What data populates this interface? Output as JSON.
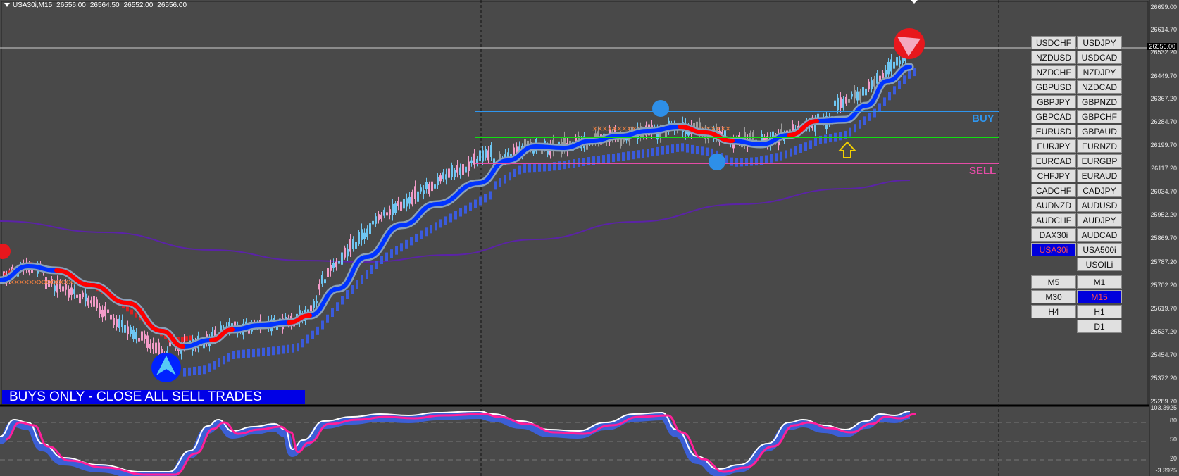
{
  "header": {
    "symbol": "USA30i,M15",
    "open": "26556.00",
    "high": "26564.50",
    "low": "26552.00",
    "close": "26556.00"
  },
  "price_axis": [
    "26699.00",
    "26614.70",
    "26532.20",
    "26449.70",
    "26367.20",
    "26284.70",
    "26199.70",
    "26117.20",
    "26034.70",
    "25952.20",
    "25869.70",
    "25787.20",
    "25702.20",
    "25619.70",
    "25537.20",
    "25454.70",
    "25372.20",
    "25289.70"
  ],
  "current_price": "26556.00",
  "indicator_axis": [
    "103.3925",
    "80",
    "50",
    "20",
    "-3.3925"
  ],
  "levels": {
    "buy_label": "BUY",
    "sell_label": "SELL"
  },
  "banner": "BUYS ONLY - CLOSE ALL SELL TRADES",
  "symbols": [
    [
      "USDCHF",
      "USDJPY"
    ],
    [
      "NZDUSD",
      "USDCAD"
    ],
    [
      "NZDCHF",
      "NZDJPY"
    ],
    [
      "GBPUSD",
      "NZDCAD"
    ],
    [
      "GBPJPY",
      "GBPNZD"
    ],
    [
      "GBPCAD",
      "GBPCHF"
    ],
    [
      "EURUSD",
      "GBPAUD"
    ],
    [
      "EURJPY",
      "EURNZD"
    ],
    [
      "EURCAD",
      "EURGBP"
    ],
    [
      "CHFJPY",
      "EURAUD"
    ],
    [
      "CADCHF",
      "CADJPY"
    ],
    [
      "AUDNZD",
      "AUDUSD"
    ],
    [
      "AUDCHF",
      "AUDJPY"
    ],
    [
      "DAX30i",
      "AUDCAD"
    ],
    [
      "USA30i",
      "USA500i"
    ],
    [
      "",
      "USOILi"
    ]
  ],
  "active_symbol": "USA30i",
  "timeframes": [
    [
      "M5",
      "M1"
    ],
    [
      "M30",
      "M15"
    ],
    [
      "H4",
      "H1"
    ],
    [
      "",
      "D1"
    ]
  ],
  "active_timeframe": "M15",
  "colors": {
    "background": "#494949",
    "buy": "#2f96ef",
    "sell": "#e54ca7",
    "mid": "#11dd11",
    "bull_candle": "#6ec6f2",
    "bear_candle": "#f29bc8",
    "flat_candle": "#9a9a9a",
    "ma_up": "#0033ff",
    "ma_down": "#ff0000",
    "long_ma": "#5b23a7"
  },
  "icons": [
    "buy-arrow-icon",
    "sell-arrow-icon",
    "up-arrow-icon",
    "dropdown-triangle-icon"
  ]
}
